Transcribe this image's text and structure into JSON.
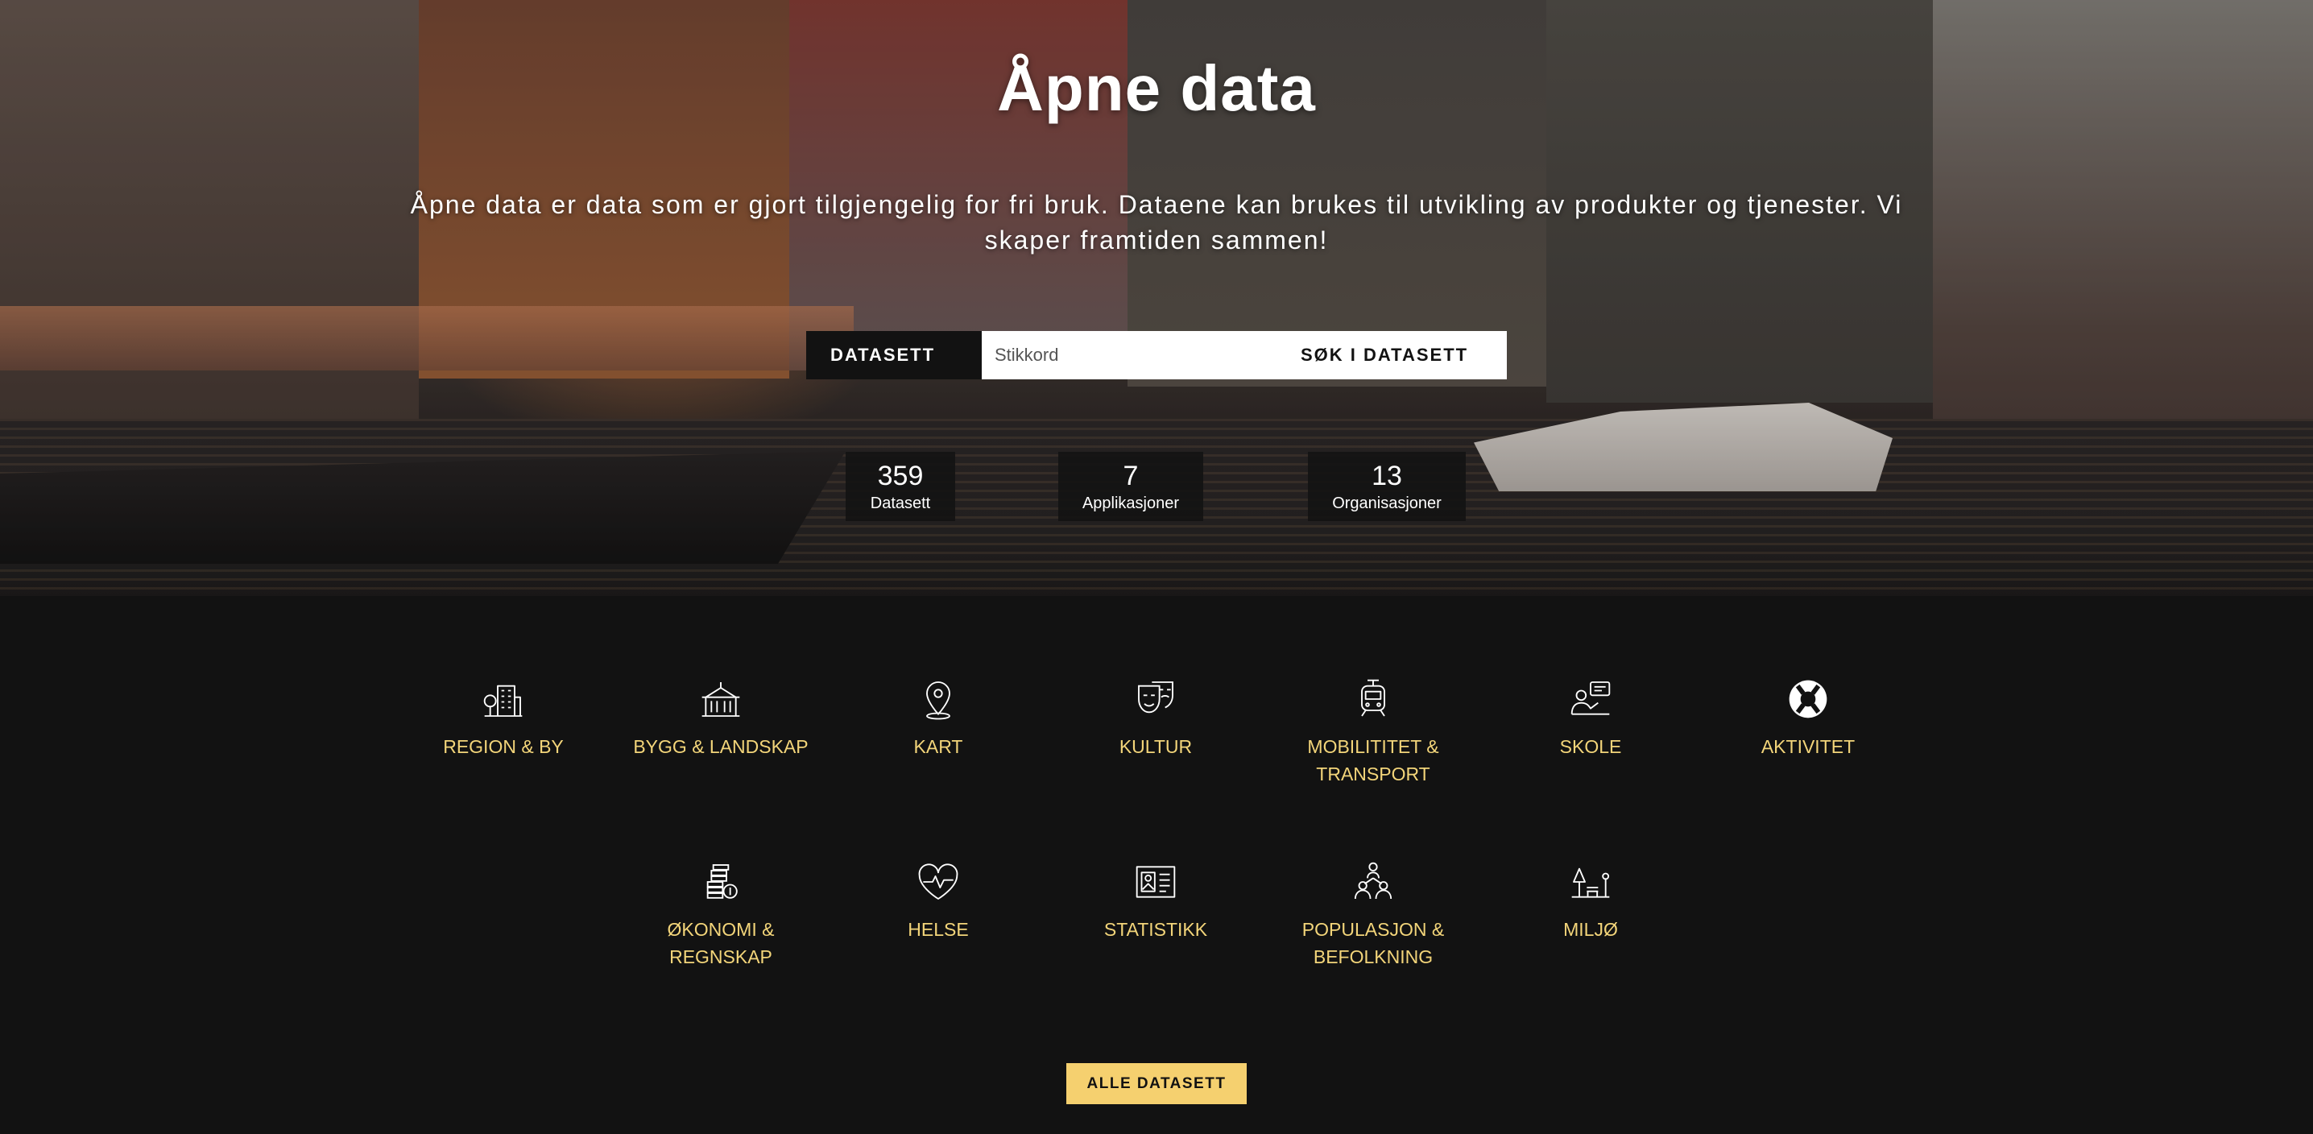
{
  "hero": {
    "title": "Åpne data",
    "description": "Åpne data er data som er gjort tilgjengelig for fri bruk. Dataene kan brukes til utvikling av produkter og tjenester. Vi skaper framtiden sammen!"
  },
  "search": {
    "type_label": "DATASETT",
    "placeholder": "Stikkord",
    "button_label": "SØK I DATASETT"
  },
  "stats": [
    {
      "value": "359",
      "label": "Datasett"
    },
    {
      "value": "7",
      "label": "Applikasjoner"
    },
    {
      "value": "13",
      "label": "Organisasjoner"
    }
  ],
  "categories": [
    {
      "label": "REGION & BY",
      "icon": "city-icon"
    },
    {
      "label": "BYGG & LANDSKAP",
      "icon": "building-icon"
    },
    {
      "label": "KART",
      "icon": "map-pin-icon"
    },
    {
      "label": "KULTUR",
      "icon": "theater-masks-icon"
    },
    {
      "label": "MOBILITITET & TRANSPORT",
      "icon": "tram-icon"
    },
    {
      "label": "SKOLE",
      "icon": "teacher-icon"
    },
    {
      "label": "AKTIVITET",
      "icon": "lifebuoy-icon"
    },
    {
      "label": "ØKONOMI & REGNSKAP",
      "icon": "coins-icon"
    },
    {
      "label": "HELSE",
      "icon": "heart-pulse-icon"
    },
    {
      "label": "STATISTIKK",
      "icon": "stats-card-icon"
    },
    {
      "label": "POPULASJON & BEFOLKNING",
      "icon": "people-icon"
    },
    {
      "label": "MILJØ",
      "icon": "park-icon"
    }
  ],
  "all_button_label": "ALLE DATASETT",
  "colors": {
    "accent": "#f5d06f",
    "category_text": "#f3d57a",
    "background": "#121212"
  }
}
